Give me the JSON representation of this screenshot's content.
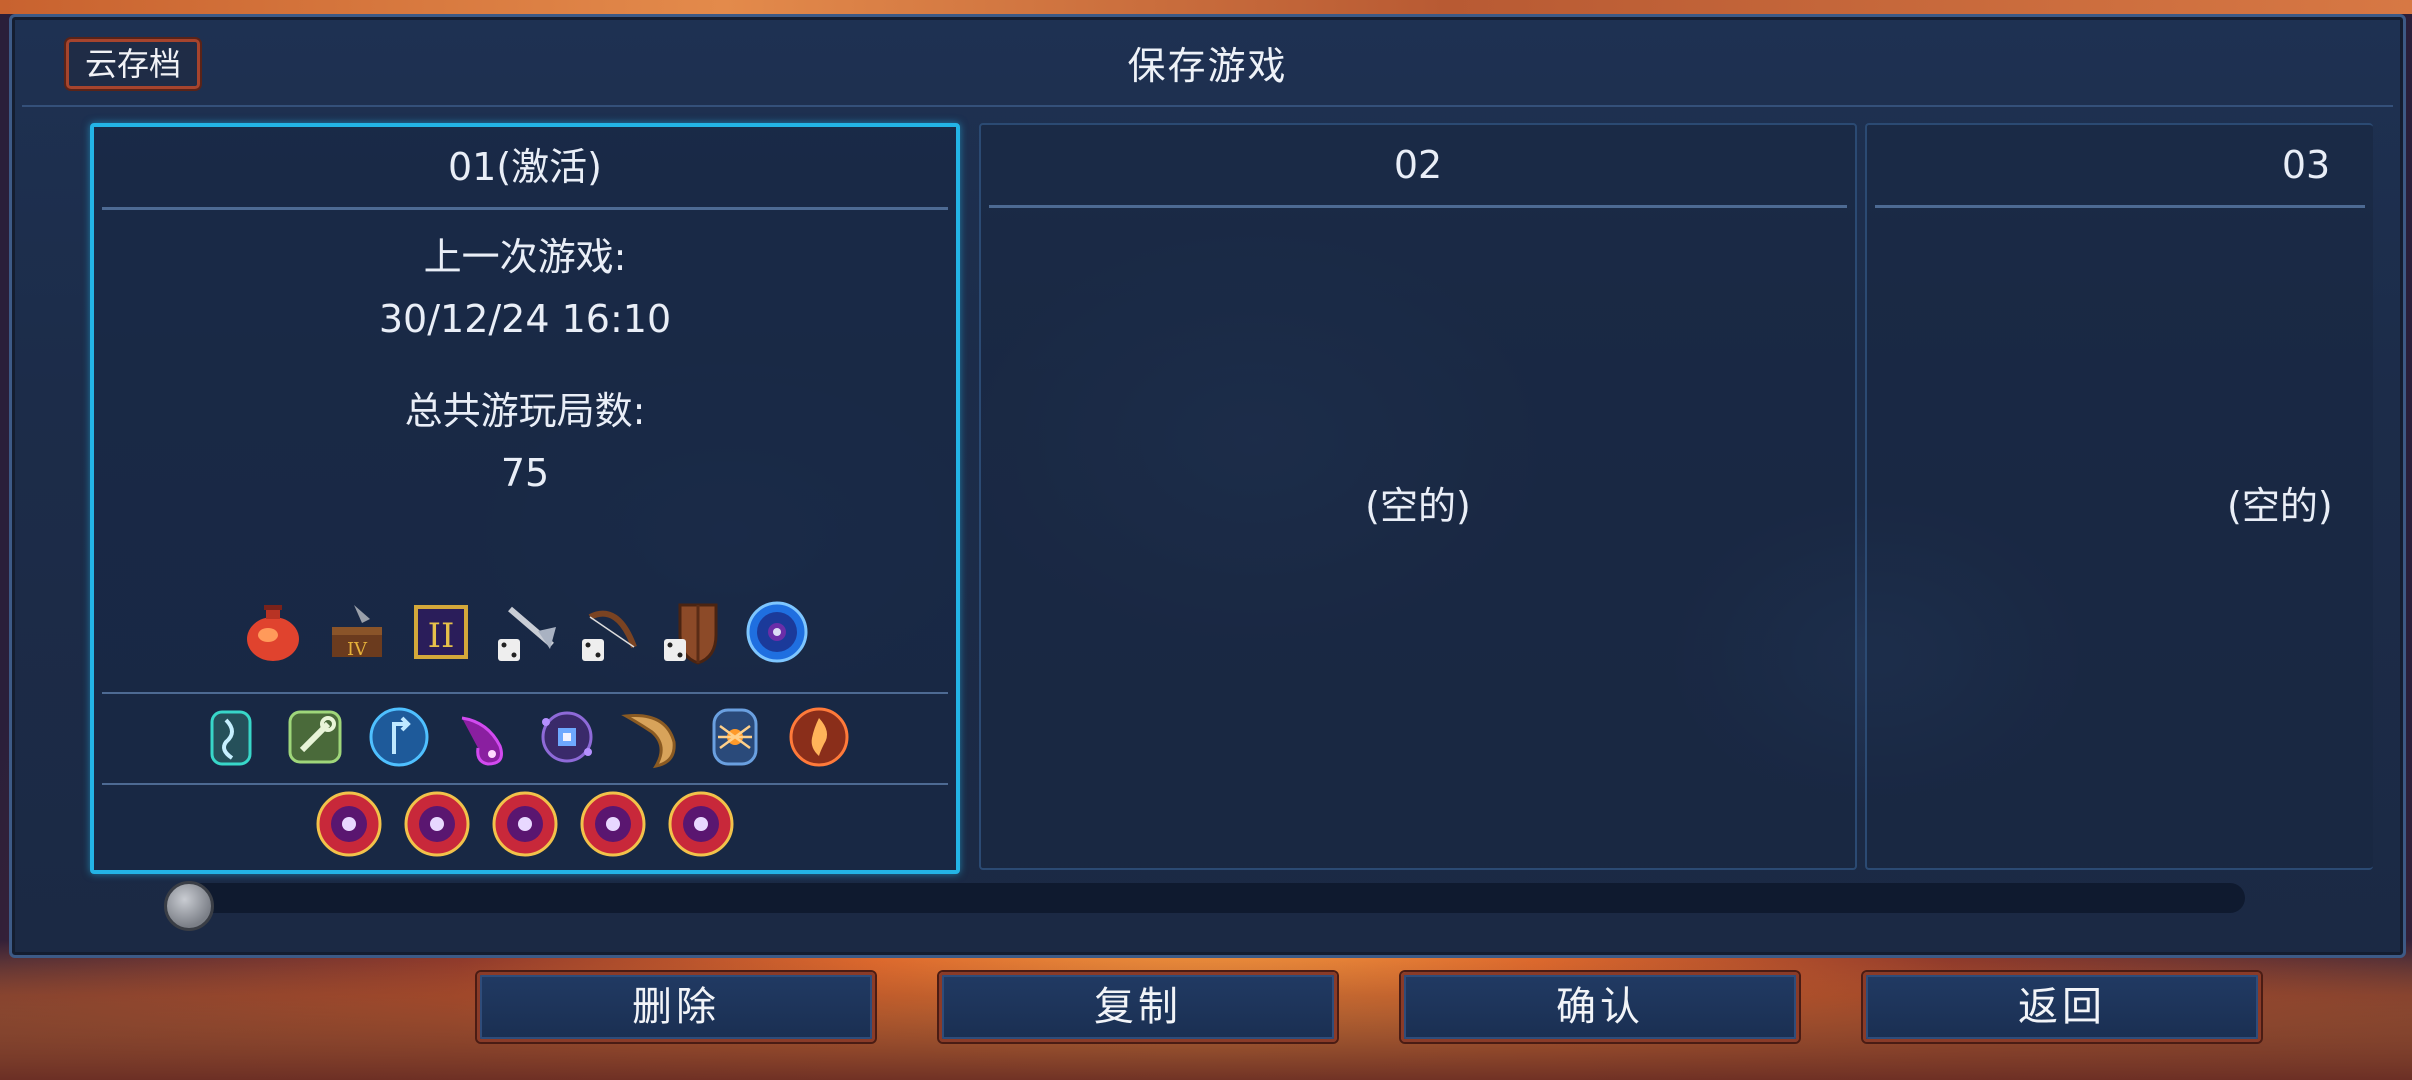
{
  "header": {
    "title": "保存游戏",
    "cloud_button": "云存档"
  },
  "slots": [
    {
      "id": "01(激活)",
      "active": true,
      "last_played_label": "上一次游戏:",
      "last_played_value": "30/12/24 16:10",
      "total_runs_label": "总共游玩局数:",
      "total_runs_value": "75",
      "item_icons": [
        "red-potion-icon",
        "treasure-chest-icon",
        "scroll-icon",
        "dice-axe-icon",
        "dice-bow-icon",
        "dice-shield-icon",
        "blue-orb-icon"
      ],
      "rune_icons": [
        "vine-rune-icon",
        "wrench-rune-icon",
        "teleport-rune-icon",
        "tentacle-rune-icon",
        "eye-rune-icon",
        "horn-rune-icon",
        "spider-rune-icon",
        "flame-rune-icon"
      ],
      "boss_cell_icons": [
        "boss-cell-icon",
        "boss-cell-icon",
        "boss-cell-icon",
        "boss-cell-icon",
        "boss-cell-icon"
      ]
    },
    {
      "id": "02",
      "active": false,
      "empty_label": "(空的)"
    },
    {
      "id": "03",
      "active": false,
      "empty_label": "(空的)"
    }
  ],
  "scroll": {
    "position": 0.0
  },
  "buttons": {
    "delete": "删除",
    "copy": "复制",
    "confirm": "确认",
    "back": "返回"
  },
  "colors": {
    "active_border": "#23b4e6",
    "button_border": "#8a3b28",
    "panel_bg": "#1e3152"
  }
}
